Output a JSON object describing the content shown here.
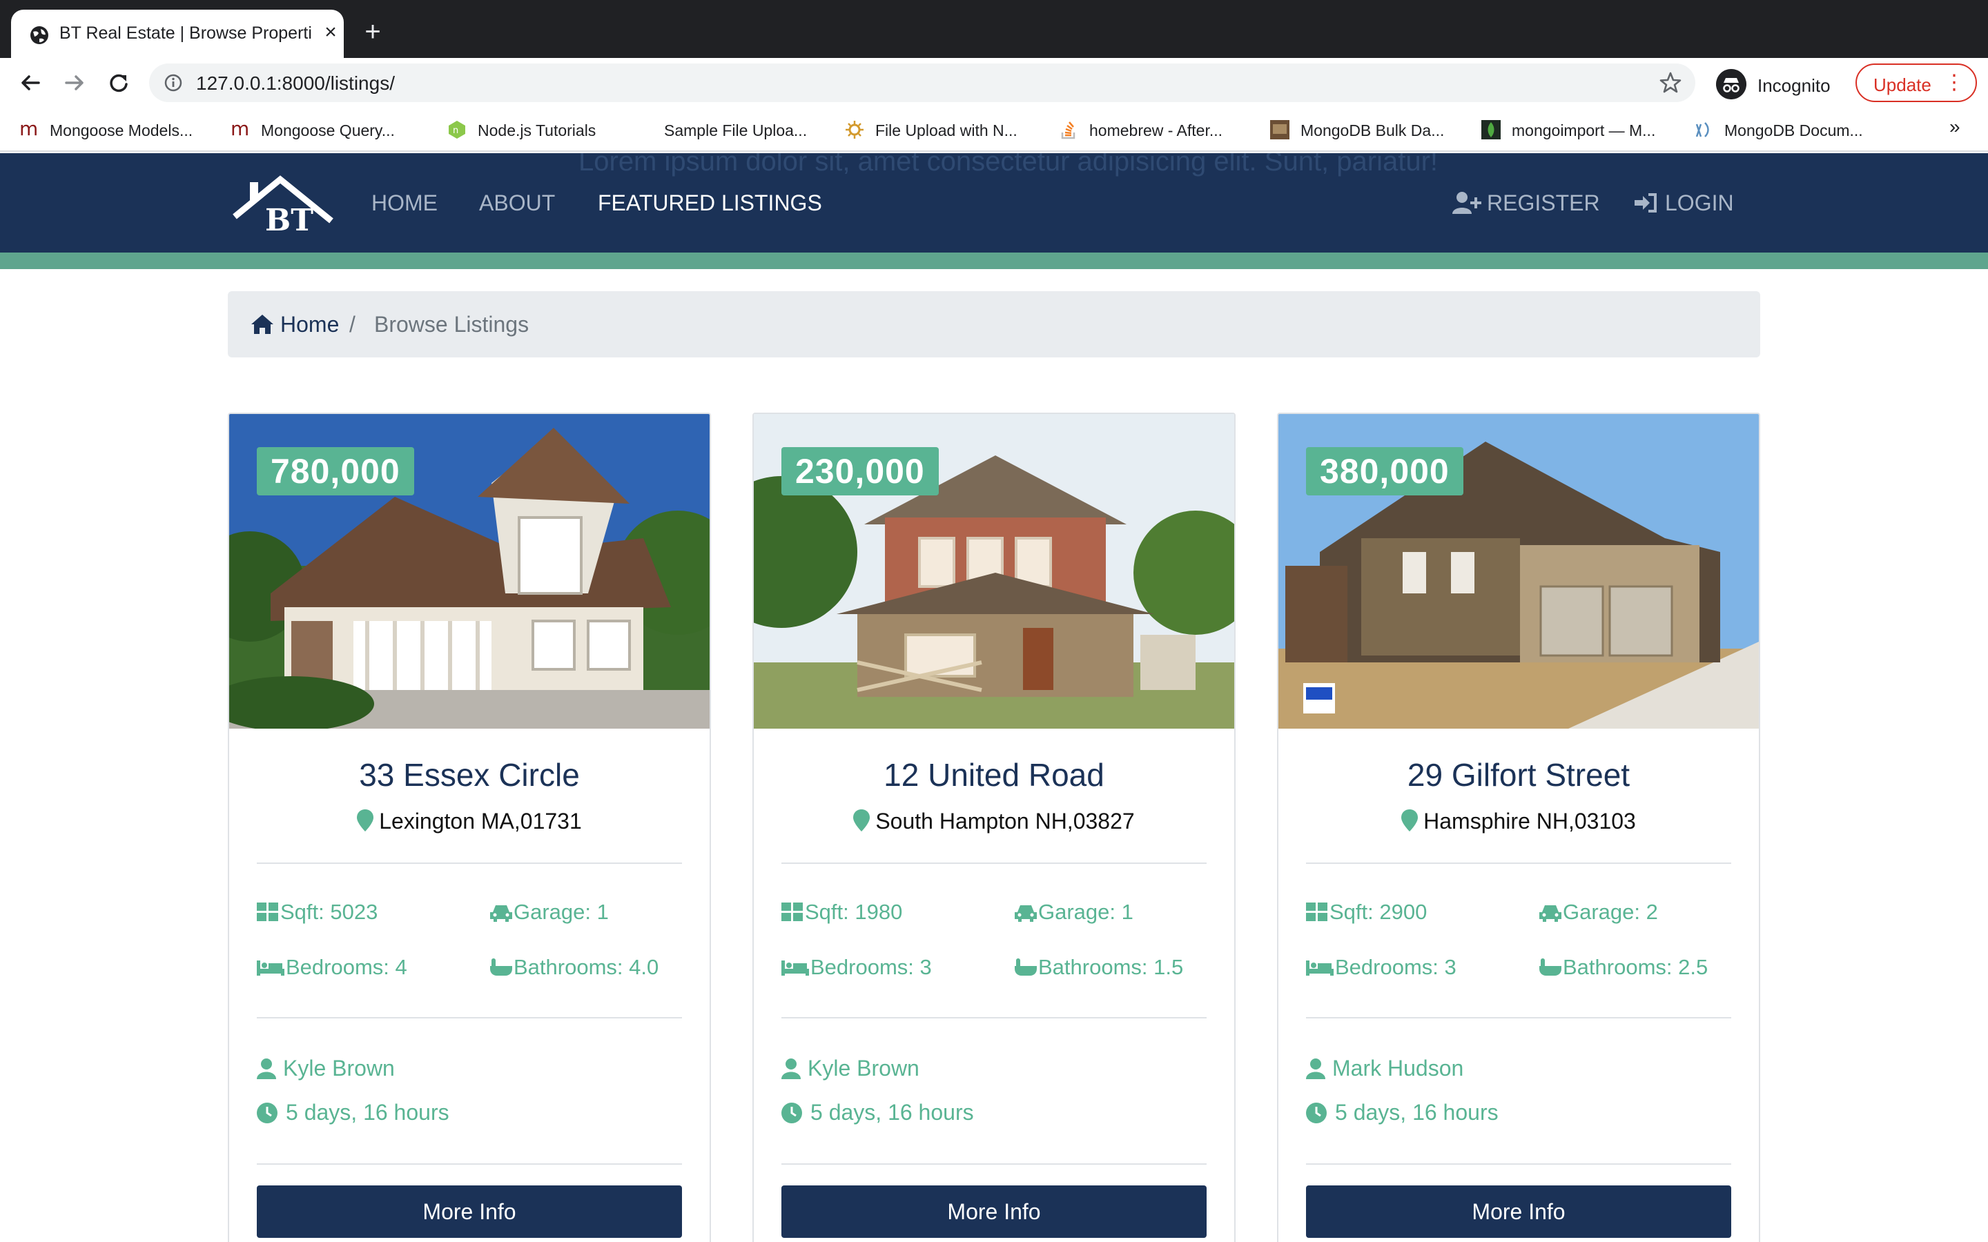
{
  "browser": {
    "tab_title": "BT Real Estate | Browse Properties",
    "url": "127.0.0.1:8000/listings/",
    "incognito_label": "Incognito",
    "update_label": "Update",
    "bookmarks": [
      {
        "label": "Mongoose Models...",
        "icon": "mongoose-icon"
      },
      {
        "label": "Mongoose Query...",
        "icon": "mongoose-icon"
      },
      {
        "label": "Node.js Tutorials",
        "icon": "nodejs-icon"
      },
      {
        "label": "Sample File Uploa...",
        "icon": "blank-page-icon"
      },
      {
        "label": "File Upload with N...",
        "icon": "gear-sun-icon"
      },
      {
        "label": "homebrew - After...",
        "icon": "stackoverflow-icon"
      },
      {
        "label": "MongoDB Bulk Da...",
        "icon": "thumbnail-icon"
      },
      {
        "label": "mongoimport — M...",
        "icon": "mongodb-leaf-icon"
      },
      {
        "label": "MongoDB Docum...",
        "icon": "docs-icon"
      }
    ],
    "more_label": "»"
  },
  "site": {
    "ghost_text": "Lorem ipsum dolor sit, amet consectetur adipisicing elit. Sunt, pariatur!",
    "nav": {
      "home": "HOME",
      "about": "ABOUT",
      "featured": "FEATURED LISTINGS",
      "register": "REGISTER",
      "login": "LOGIN"
    },
    "colors": {
      "navy": "#1b3257",
      "accent": "#59b493"
    }
  },
  "breadcrumb": {
    "home": "Home",
    "separator": "/",
    "current": "Browse Listings"
  },
  "listings": [
    {
      "price": "780,000",
      "address": "33 Essex Circle",
      "city": "Lexington MA,01731",
      "sqft": "Sqft: 5023",
      "garage": "Garage: 1",
      "bedrooms": "Bedrooms: 4",
      "bathrooms": "Bathrooms: 4.0",
      "realtor": "Kyle Brown",
      "listed": "5 days, 16 hours",
      "button": "More Info"
    },
    {
      "price": "230,000",
      "address": "12 United Road",
      "city": "South Hampton NH,03827",
      "sqft": "Sqft: 1980",
      "garage": "Garage: 1",
      "bedrooms": "Bedrooms: 3",
      "bathrooms": "Bathrooms: 1.5",
      "realtor": "Kyle Brown",
      "listed": "5 days, 16 hours",
      "button": "More Info"
    },
    {
      "price": "380,000",
      "address": "29 Gilfort Street",
      "city": "Hamsphire NH,03103",
      "sqft": "Sqft: 2900",
      "garage": "Garage: 2",
      "bedrooms": "Bedrooms: 3",
      "bathrooms": "Bathrooms: 2.5",
      "realtor": "Mark Hudson",
      "listed": "5 days, 16 hours",
      "button": "More Info"
    }
  ]
}
